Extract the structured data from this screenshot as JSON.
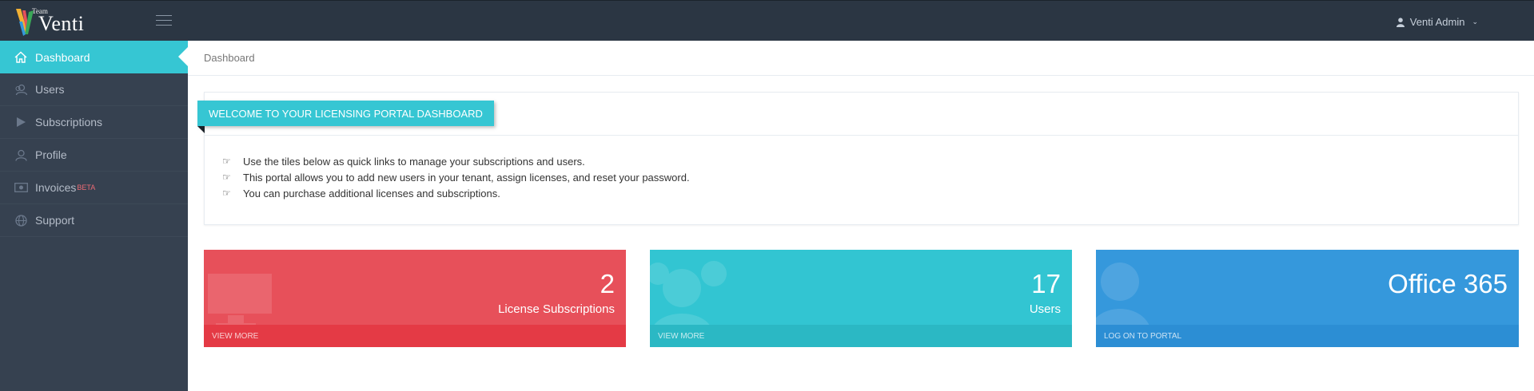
{
  "header": {
    "logo_small": "Team",
    "logo_name": "Venti",
    "user_name": "Venti Admin"
  },
  "sidebar": {
    "items": [
      {
        "label": "Dashboard",
        "icon": "home-icon"
      },
      {
        "label": "Users",
        "icon": "users-icon"
      },
      {
        "label": "Subscriptions",
        "icon": "play-icon"
      },
      {
        "label": "Profile",
        "icon": "user-icon"
      },
      {
        "label": "Invoices",
        "badge": "BETA",
        "icon": "money-icon"
      },
      {
        "label": "Support",
        "icon": "globe-icon"
      }
    ]
  },
  "breadcrumb": "Dashboard",
  "welcome": {
    "title": "WELCOME TO YOUR LICENSING PORTAL DASHBOARD",
    "tips": [
      "Use the tiles below as quick links to manage your subscriptions and users.",
      "This portal allows you to add new users in your tenant, assign licenses, and reset your password.",
      "You can purchase additional licenses and subscriptions."
    ]
  },
  "tiles": [
    {
      "number": "2",
      "desc": "License Subscriptions",
      "link": "VIEW MORE",
      "color": "#e7505a"
    },
    {
      "number": "17",
      "desc": "Users",
      "link": "VIEW MORE",
      "color": "#32c5d2"
    },
    {
      "number": "Office 365",
      "desc": "",
      "link": "LOG ON TO PORTAL",
      "color": "#3598dc"
    }
  ],
  "colors": {
    "topbar": "#2b3643",
    "sidebar": "#364150",
    "accent": "#36c6d3"
  }
}
